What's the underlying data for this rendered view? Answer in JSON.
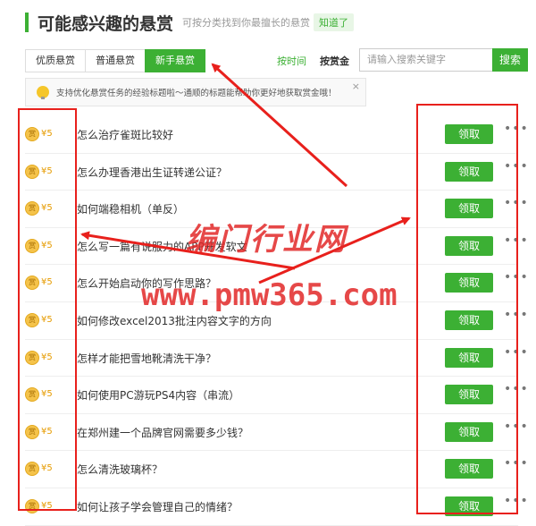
{
  "header": {
    "title": "可能感兴趣的悬赏",
    "hint": "可按分类找到你最擅长的悬赏",
    "button": "知道了"
  },
  "tabs": [
    {
      "label": "优质悬赏",
      "active": false
    },
    {
      "label": "普通悬赏",
      "active": false
    },
    {
      "label": "新手悬赏",
      "active": true
    }
  ],
  "sort": {
    "time": "按时间",
    "bounty": "按赏金"
  },
  "search": {
    "placeholder": "请输入搜索关键字",
    "button": "搜索"
  },
  "notice": {
    "text": "支持优化悬赏任务的经验标题啦～通顺的标题能帮助你更好地获取赏金哦！",
    "close": "×"
  },
  "coin_label": "赏",
  "claim_label": "领取",
  "more_label": "•••",
  "rows": [
    {
      "amount": "¥5",
      "question": "怎么治疗雀斑比较好"
    },
    {
      "amount": "¥5",
      "question": "怎么办理香港出生证转递公证？"
    },
    {
      "amount": "¥5",
      "question": "如何端稳相机（单反）"
    },
    {
      "amount": "¥5",
      "question": "怎么写一篇有说服力的APP开发软文"
    },
    {
      "amount": "¥5",
      "question": "怎么开始启动你的写作思路？"
    },
    {
      "amount": "¥5",
      "question": "如何修改excel2013批注内容文字的方向"
    },
    {
      "amount": "¥5",
      "question": "怎样才能把雪地靴清洗干净？"
    },
    {
      "amount": "¥5",
      "question": "如何使用PC游玩PS4内容（串流）"
    },
    {
      "amount": "¥5",
      "question": "在郑州建一个品牌官网需要多少钱？"
    },
    {
      "amount": "¥5",
      "question": "怎么清洗玻璃杯？"
    },
    {
      "amount": "¥5",
      "question": "如何让孩子学会管理自己的情绪？"
    }
  ],
  "watermark": {
    "line1": "编门行业网",
    "line2": "www.pmw365.com"
  },
  "colors": {
    "accent": "#3cb034",
    "annotation": "#e8201c",
    "coin": "#f5c34a"
  }
}
